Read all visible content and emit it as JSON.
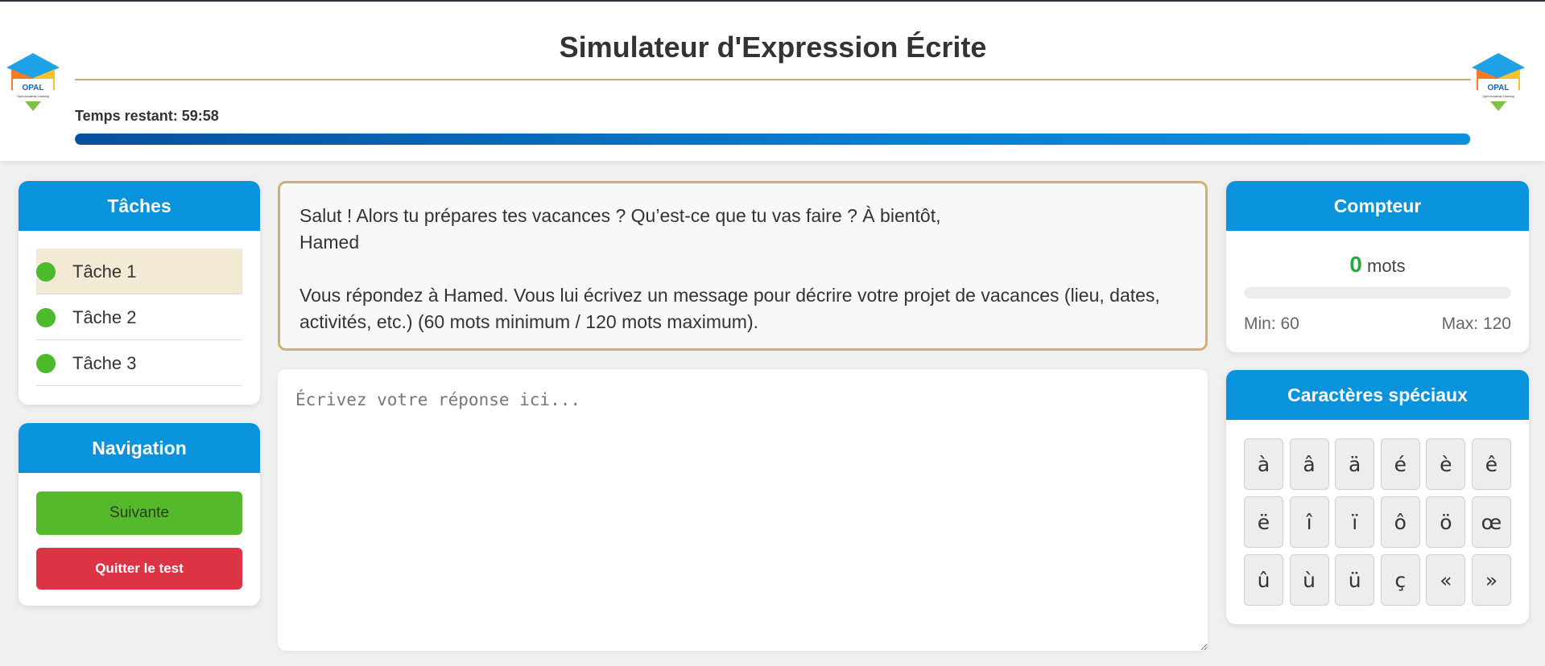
{
  "header": {
    "title": "Simulateur d'Expression Écrite",
    "timer": "Temps restant: 59:58",
    "progress": 0.9995,
    "logo_text": "OPAL",
    "logo_subtext": "Open Academic Learning"
  },
  "tasks": {
    "title": "Tâches",
    "items": [
      {
        "label": "Tâche 1",
        "active": true
      },
      {
        "label": "Tâche 2",
        "active": false
      },
      {
        "label": "Tâche 3",
        "active": false
      }
    ]
  },
  "navigation": {
    "title": "Navigation",
    "next_label": "Suivante",
    "quit_label": "Quitter le test"
  },
  "prompt": {
    "line1": "Salut ! Alors tu prépares tes vacances ? Qu’est-ce que tu vas faire ? À bientôt,",
    "line2": "Hamed",
    "instruction": "Vous répondez à Hamed. Vous lui écrivez un message pour décrire votre projet de vacances (lieu, dates, activités, etc.) (60 mots minimum / 120 mots maximum)."
  },
  "editor": {
    "placeholder": "Écrivez votre réponse ici...",
    "value": ""
  },
  "counter": {
    "title": "Compteur",
    "count": "0",
    "unit": "mots",
    "min_label": "Min: 60",
    "max_label": "Max: 120"
  },
  "special": {
    "title": "Caractères spéciaux",
    "chars": [
      "à",
      "â",
      "ä",
      "é",
      "è",
      "ê",
      "ë",
      "î",
      "ï",
      "ô",
      "ö",
      "œ",
      "û",
      "ù",
      "ü",
      "ç",
      "«",
      "»"
    ]
  },
  "colors": {
    "accent": "#0a93dd",
    "success": "#55b92c",
    "danger": "#dc3445",
    "prompt_border": "#d7ad6b",
    "active_task_bg": "#f3ead5"
  }
}
